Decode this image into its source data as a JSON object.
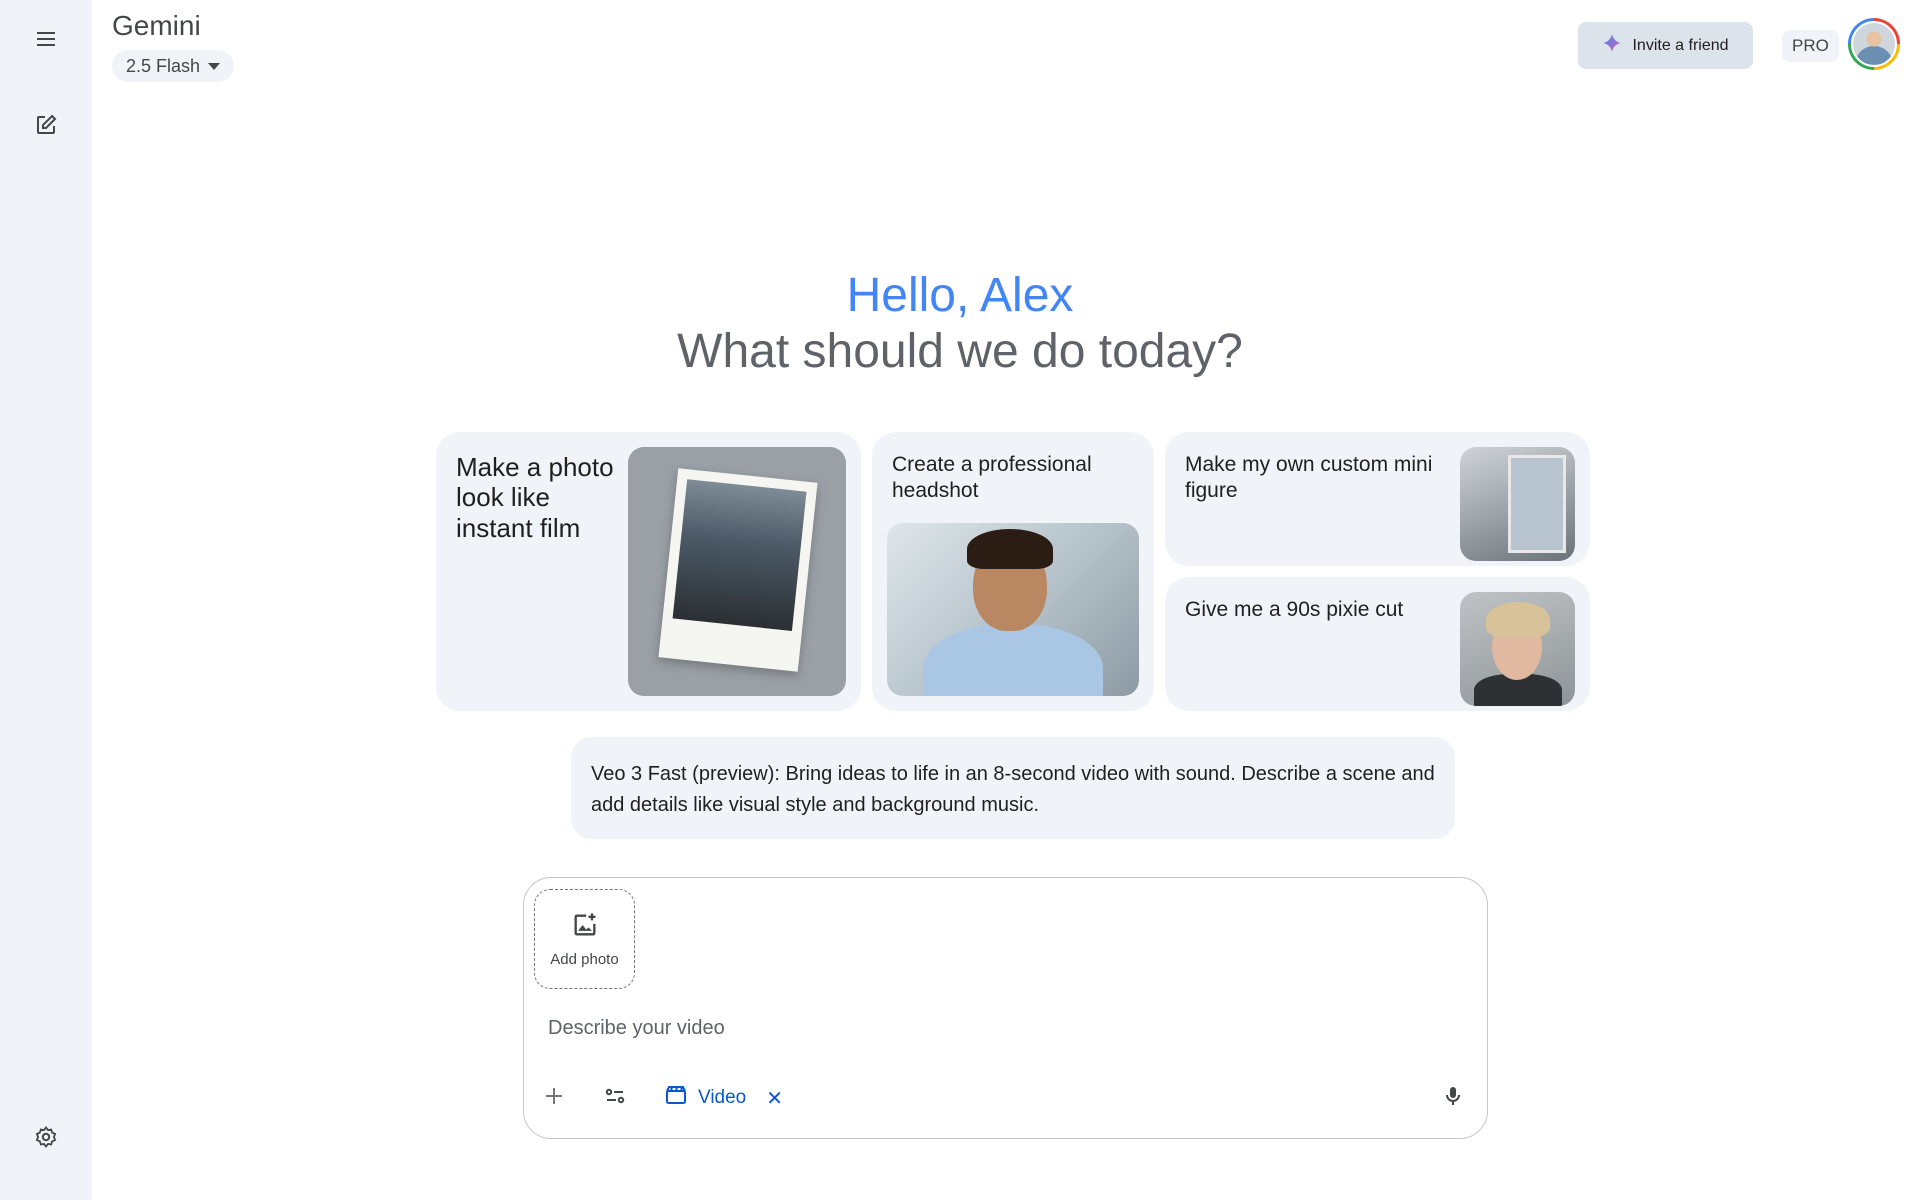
{
  "app": {
    "title": "Gemini",
    "model": "2.5 Flash"
  },
  "header": {
    "invite_label": "Invite a friend",
    "plan_badge": "PRO"
  },
  "greeting": {
    "name_line": "Hello, Alex",
    "question": "What should we do today?"
  },
  "cards": [
    {
      "title": "Make a photo look like instant film"
    },
    {
      "title": "Create a professional headshot"
    },
    {
      "title": "Make my own custom mini figure"
    },
    {
      "title": "Give me a 90s pixie cut"
    }
  ],
  "info": {
    "text": "Veo 3 Fast (preview): Bring ideas to life in an 8-second video with sound. Describe a scene and add details like visual style and background music."
  },
  "composer": {
    "add_photo_label": "Add photo",
    "placeholder": "Describe your video",
    "value": "",
    "mode_chip_label": "Video",
    "mode_chip_close": "✕"
  },
  "icons": {
    "menu": "hamburger-menu-icon",
    "new_chat": "edit-square-icon",
    "settings": "gear-icon",
    "sparkle": "sparkle-icon",
    "add_photo": "image-plus-icon",
    "plus": "plus-icon",
    "tools": "tune-icon",
    "video": "clapperboard-icon",
    "mic": "microphone-icon"
  },
  "colors": {
    "accent": "#4285f4",
    "link": "#0b57d0",
    "surface": "#f0f4f9"
  }
}
